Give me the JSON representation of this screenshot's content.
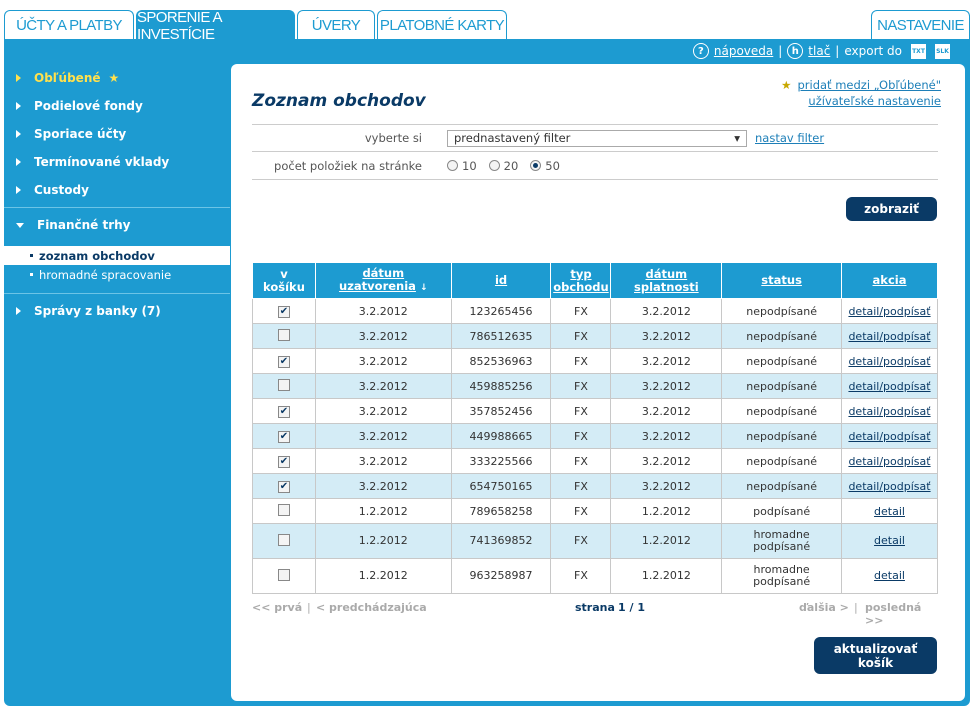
{
  "tabs": [
    {
      "label": "ÚČTY A PLATBY"
    },
    {
      "label": "SPORENIE A INVESTÍCIE"
    },
    {
      "label": "ÚVERY"
    },
    {
      "label": "PLATOBNÉ KARTY"
    },
    {
      "label": "NASTAVENIE"
    }
  ],
  "toolbar": {
    "help_icon": "?",
    "help": "nápoveda",
    "sep1": "|",
    "print_icon": "h",
    "print": "tlač",
    "sep2": "|",
    "export_label": "export do",
    "export1": "TXT",
    "export2": "SLK"
  },
  "sidebar": {
    "items": [
      {
        "label": "Obľúbené",
        "star": "★"
      },
      {
        "label": "Podielové fondy"
      },
      {
        "label": "Sporiace účty"
      },
      {
        "label": "Termínované vklady"
      },
      {
        "label": "Custody"
      },
      {
        "label": "Finančné trhy"
      },
      {
        "label": "zoznam obchodov"
      },
      {
        "label": "hromadné spracovanie"
      },
      {
        "label": "Správy z banky (7)"
      }
    ]
  },
  "page": {
    "title": "Zoznam obchodov",
    "star": "★",
    "fav_link": "pridať medzi „Obľúbené\"",
    "settings_link": "užívateľské nastavenie",
    "filter_label": "vyberte si",
    "filter_value": "prednastavený filter",
    "filter_arrow": "▾",
    "filter_link": "nastav filter",
    "count_label": "počet položiek na stránke",
    "count_options": [
      "10",
      "20",
      "50"
    ],
    "count_selected": "50",
    "show_button": "zobraziť",
    "update_button_1": "aktualizovať",
    "update_button_2": "košík"
  },
  "table": {
    "headers": {
      "basket": [
        "v",
        "košíku"
      ],
      "date_closed": [
        "dátum",
        "uzatvorenia"
      ],
      "sort_icon": "↓",
      "id": "id",
      "type": [
        "typ",
        "obchodu"
      ],
      "date_due": [
        "dátum",
        "splatnosti"
      ],
      "status": "status",
      "action": "akcia"
    },
    "check_mark": "✔",
    "rows": [
      {
        "checked": true,
        "date": "3.2.2012",
        "id": "123265456",
        "type": "FX",
        "due": "3.2.2012",
        "status": [
          "nepodpísané"
        ],
        "action": "detail/podpísať"
      },
      {
        "checked": false,
        "date": "3.2.2012",
        "id": "786512635",
        "type": "FX",
        "due": "3.2.2012",
        "status": [
          "nepodpísané"
        ],
        "action": "detail/podpísať"
      },
      {
        "checked": true,
        "date": "3.2.2012",
        "id": "852536963",
        "type": "FX",
        "due": "3.2.2012",
        "status": [
          "nepodpísané"
        ],
        "action": "detail/podpísať"
      },
      {
        "checked": false,
        "date": "3.2.2012",
        "id": "459885256",
        "type": "FX",
        "due": "3.2.2012",
        "status": [
          "nepodpísané"
        ],
        "action": "detail/podpísať"
      },
      {
        "checked": true,
        "date": "3.2.2012",
        "id": "357852456",
        "type": "FX",
        "due": "3.2.2012",
        "status": [
          "nepodpísané"
        ],
        "action": "detail/podpísať"
      },
      {
        "checked": true,
        "date": "3.2.2012",
        "id": "449988665",
        "type": "FX",
        "due": "3.2.2012",
        "status": [
          "nepodpísané"
        ],
        "action": "detail/podpísať"
      },
      {
        "checked": true,
        "date": "3.2.2012",
        "id": "333225566",
        "type": "FX",
        "due": "3.2.2012",
        "status": [
          "nepodpísané"
        ],
        "action": "detail/podpísať"
      },
      {
        "checked": true,
        "date": "3.2.2012",
        "id": "654750165",
        "type": "FX",
        "due": "3.2.2012",
        "status": [
          "nepodpísané"
        ],
        "action": "detail/podpísať"
      },
      {
        "checked": false,
        "date": "1.2.2012",
        "id": "789658258",
        "type": "FX",
        "due": "1.2.2012",
        "status": [
          "podpísané"
        ],
        "action": "detail"
      },
      {
        "checked": false,
        "date": "1.2.2012",
        "id": "741369852",
        "type": "FX",
        "due": "1.2.2012",
        "status": [
          "hromadne",
          "podpísané"
        ],
        "action": "detail"
      },
      {
        "checked": false,
        "date": "1.2.2012",
        "id": "963258987",
        "type": "FX",
        "due": "1.2.2012",
        "status": [
          "hromadne",
          "podpísané"
        ],
        "action": "detail"
      }
    ]
  },
  "pager": {
    "first": "<< prvá",
    "sep": "|",
    "prev": "< predchádzajúca",
    "page_label": "strana",
    "page_value": "1 / 1",
    "next": "ďalšia >",
    "last": "posledná >>"
  },
  "colors": {
    "accent": "#1d9bd1",
    "dark": "#0a3a66",
    "row_alt": "#d4ecf6",
    "favorite": "#ffe14d"
  }
}
